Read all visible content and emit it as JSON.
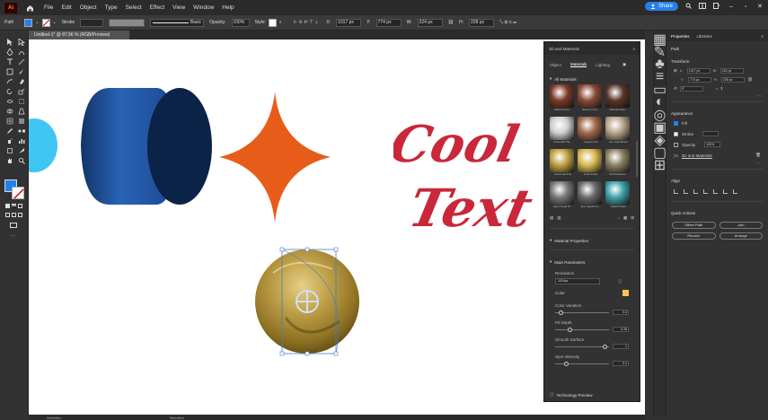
{
  "menubar": {
    "logo": "Ai",
    "items": [
      "File",
      "Edit",
      "Object",
      "Type",
      "Select",
      "Effect",
      "View",
      "Window",
      "Help"
    ],
    "share": "Share"
  },
  "controlbar": {
    "path": "Path",
    "stroke": "Stroke",
    "basic": "Basic",
    "opacity_label": "Opacity:",
    "opacity_value": "100%",
    "style_label": "Style:",
    "x": "1017 px",
    "y": "774 px",
    "w": "224 px",
    "h": "228 px"
  },
  "doc": {
    "tab": "Untitled-1* @ 87.56 % (RGB/Preview)",
    "status_left": "Selection",
    "status_right": "Selection"
  },
  "canvas_text": {
    "line1": "Cool",
    "line2": "Text"
  },
  "panel3d": {
    "title": "3D and Materials",
    "tabs": [
      "Object",
      "Materials",
      "Lighting"
    ],
    "all_materials": "All Materials",
    "materials": [
      {
        "label": "Natural Cork...",
        "color": "#7a3a28"
      },
      {
        "label": "Natural Crea...",
        "color": "#8a4a36"
      },
      {
        "label": "Natural Shap...",
        "color": "#5a3528"
      },
      {
        "label": "Coloredfo Pla...",
        "color": "#cfcfcf"
      },
      {
        "label": "Copper Foil",
        "color": "#a06a4a"
      },
      {
        "label": "Ore Cast Brush",
        "color": "#b8a58c"
      },
      {
        "label": "Gold Leaf Foil",
        "color": "#c0a040"
      },
      {
        "label": "Gold Nickel",
        "color": "#d8b850"
      },
      {
        "label": "Soft Reteleno...",
        "color": "#8a8060"
      },
      {
        "label": "Steel Tread Pl...",
        "color": "#777777"
      },
      {
        "label": "Zinc Spade Fo...",
        "color": "#6a6a6a"
      },
      {
        "label": "Marble Paint",
        "color": "#3fa0a8"
      }
    ],
    "material_properties": "Material Properties",
    "main_parameters": "Main Parameters",
    "resolution_label": "Resolution",
    "resolution_value": "1024px",
    "color_label": "Color",
    "color_value": "#f7c64b",
    "sliders": [
      {
        "label": "Color Variation",
        "value": "0.6",
        "pos": 0.1
      },
      {
        "label": "Pit Depth",
        "value": "0.28",
        "pos": 0.28
      },
      {
        "label": "Smooth Surface",
        "value": "1",
        "pos": 0.92
      },
      {
        "label": "Spot Intensity",
        "value": "0.2",
        "pos": 0.2
      }
    ],
    "footer": "Technology Preview"
  },
  "props": {
    "tabs": [
      "Properties",
      "Libraries"
    ],
    "path": "Path",
    "transform": "Transform",
    "x": "1017 px",
    "y": "774 px",
    "w": "224 px",
    "h": "228 px",
    "angle": "0°",
    "appearance": "Appearance",
    "fill": "Fill",
    "stroke": "Stroke",
    "opacity": "Opacity",
    "opacity_value": "100%",
    "fx": "3D and Materials",
    "align": "Align",
    "quick_actions": "Quick Actions",
    "qa": [
      "Offset Path",
      "Join",
      "Recolor",
      "Arrange"
    ]
  },
  "colors": {
    "cylinder": "#1a3f80",
    "star": "#e85c1a",
    "text": "#c8283a",
    "cyan": "#3fc6f3",
    "sphere": "#c0a040"
  }
}
